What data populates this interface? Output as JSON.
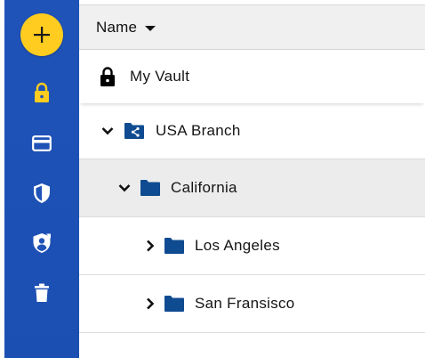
{
  "sidebar": {
    "add_button_icon": "plus-icon",
    "items": [
      {
        "icon": "lock-icon",
        "active": true
      },
      {
        "icon": "card-icon",
        "active": false
      },
      {
        "icon": "shield-icon",
        "active": false
      },
      {
        "icon": "shield-person-icon",
        "active": false
      },
      {
        "icon": "trash-icon",
        "active": false
      }
    ],
    "colors": {
      "background": "#1f53b8",
      "accent": "#ffcc1f",
      "icon": "#ffffff"
    }
  },
  "header": {
    "sort_label": "Name",
    "sort_icon": "caret-down-icon"
  },
  "tree": {
    "vault": {
      "label": "My Vault",
      "icon": "lock-icon"
    },
    "items": [
      {
        "label": "USA Branch",
        "icon": "shared-folder-icon",
        "expanded": true,
        "selected": false
      },
      {
        "label": "California",
        "icon": "folder-icon",
        "expanded": true,
        "selected": true
      },
      {
        "label": "Los Angeles",
        "icon": "folder-icon",
        "expanded": false,
        "selected": false
      },
      {
        "label": "San Fransisco",
        "icon": "folder-icon",
        "expanded": false,
        "selected": false
      }
    ],
    "colors": {
      "folder": "#0f4b91",
      "selected_row": "#ececec"
    }
  }
}
